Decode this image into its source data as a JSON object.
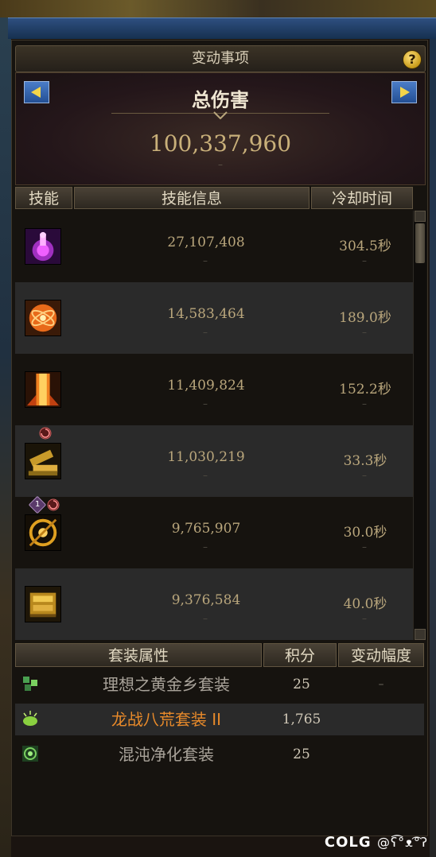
{
  "window": {
    "title": "变动事项",
    "help_label": "?"
  },
  "summary": {
    "label": "总伤害",
    "value": "100,337,960",
    "dash": "–"
  },
  "skill_table": {
    "columns": [
      "技能",
      "技能信息",
      "冷却时间"
    ],
    "rows": [
      {
        "damage": "27,107,408",
        "cooldown": "304.5秒",
        "icon": "purple-goddess-icon",
        "badges": []
      },
      {
        "damage": "14,583,464",
        "cooldown": "189.0秒",
        "icon": "orange-atom-icon",
        "badges": []
      },
      {
        "damage": "11,409,824",
        "cooldown": "152.2秒",
        "icon": "fire-pillar-icon",
        "badges": []
      },
      {
        "damage": "11,030,219",
        "cooldown": "33.3秒",
        "icon": "gold-cannon-icon",
        "badges": [
          "swirl-badge-icon"
        ]
      },
      {
        "damage": "9,765,907",
        "cooldown": "30.0秒",
        "icon": "gold-ring-blast-icon",
        "badges": [
          "rank-1-badge-icon",
          "swirl-badge-icon"
        ],
        "badge_text": "1"
      },
      {
        "damage": "9,376,584",
        "cooldown": "40.0秒",
        "icon": "gold-gear-icon",
        "badges": []
      }
    ],
    "dash": "–"
  },
  "set_table": {
    "columns": [
      "套装属性",
      "积分",
      "变动幅度"
    ],
    "rows": [
      {
        "name": "理想之黄金乡套装",
        "score": "25",
        "change": "–",
        "icon": "green-blocks-icon",
        "color": "#a9a39a"
      },
      {
        "name": "龙战八荒套装 II",
        "score": "1,765",
        "change": "",
        "icon": "green-orb-icon",
        "color": "#e88a2a"
      },
      {
        "name": "混沌净化套装",
        "score": "25",
        "change": "",
        "icon": "green-swirl-icon",
        "color": "#a9a39a"
      }
    ]
  },
  "watermark": {
    "brand": "COLG",
    "handle": "@ʕ͡°ᴥ͡°ʔ"
  },
  "colors": {
    "accent_gold": "#c9b07a",
    "epic_orange": "#e88a2a",
    "arrow_blue": "#2f5fa8"
  }
}
